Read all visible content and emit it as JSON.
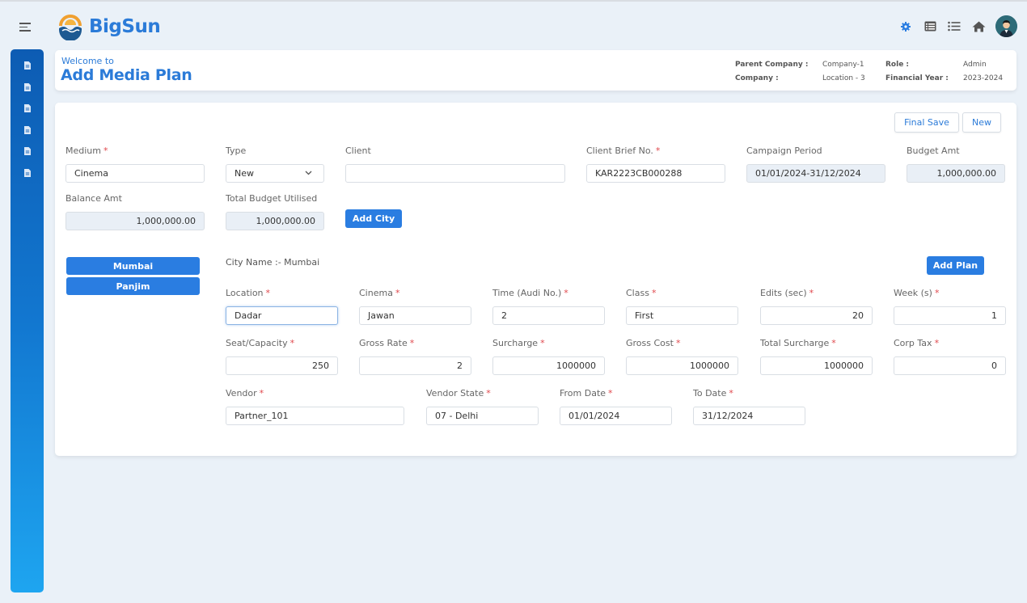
{
  "app": {
    "brand": "BigSun"
  },
  "topbar": {
    "icons": [
      "gear-icon",
      "table-icon",
      "list-icon",
      "home-icon",
      "user-avatar"
    ]
  },
  "sidebar": {
    "items": [
      {
        "icon": "document-icon"
      },
      {
        "icon": "document-icon"
      },
      {
        "icon": "document-icon"
      },
      {
        "icon": "document-icon"
      },
      {
        "icon": "document-icon"
      },
      {
        "icon": "document-icon"
      }
    ]
  },
  "header": {
    "welcome": "Welcome to",
    "title": "Add Media Plan",
    "info": {
      "parent_company_label": "Parent Company :",
      "parent_company_value": "Company-1",
      "company_label": "Company :",
      "company_value": "Location - 3",
      "role_label": "Role :",
      "role_value": "Admin",
      "fy_label": "Financial Year :",
      "fy_value": "2023-2024"
    }
  },
  "actions": {
    "final_save": "Final Save",
    "new": "New",
    "add_city": "Add City",
    "add_plan": "Add Plan"
  },
  "form": {
    "medium": {
      "label": "Medium",
      "value": "Cinema",
      "required": true
    },
    "type": {
      "label": "Type",
      "value": "New"
    },
    "client": {
      "label": "Client",
      "value": ""
    },
    "client_brief_no": {
      "label": "Client Brief No.",
      "value": "KAR2223CB000288",
      "required": true
    },
    "campaign_period": {
      "label": "Campaign Period",
      "value": "01/01/2024-31/12/2024"
    },
    "budget_amt": {
      "label": "Budget Amt",
      "value": "1,000,000.00"
    },
    "balance_amt": {
      "label": "Balance Amt",
      "value": "1,000,000.00"
    },
    "total_budget_utilised": {
      "label": "Total Budget Utilised",
      "value": "1,000,000.00"
    }
  },
  "cities": {
    "list": [
      "Mumbai",
      "Panjim"
    ],
    "selected_label": "City Name :- Mumbai"
  },
  "plan": {
    "location": {
      "label": "Location",
      "value": "Dadar"
    },
    "cinema": {
      "label": "Cinema",
      "value": "Jawan"
    },
    "time": {
      "label": "Time (Audi No.)",
      "value": "2"
    },
    "class": {
      "label": "Class",
      "value": "First"
    },
    "edits": {
      "label": "Edits (sec)",
      "value": "20"
    },
    "weeks": {
      "label": "Week (s)",
      "value": "1"
    },
    "seat_capacity": {
      "label": "Seat/Capacity",
      "value": "250"
    },
    "gross_rate": {
      "label": "Gross Rate",
      "value": "2"
    },
    "surcharge": {
      "label": "Surcharge",
      "value": "1000000"
    },
    "gross_cost": {
      "label": "Gross Cost",
      "value": "1000000"
    },
    "total_surcharge": {
      "label": "Total Surcharge",
      "value": "1000000"
    },
    "corp_tax": {
      "label": "Corp Tax",
      "value": "0"
    },
    "vendor": {
      "label": "Vendor",
      "value": "Partner_101"
    },
    "vendor_state": {
      "label": "Vendor State",
      "value": "07 - Delhi"
    },
    "from_date": {
      "label": "From Date",
      "value": "01/01/2024"
    },
    "to_date": {
      "label": "To Date",
      "value": "31/12/2024"
    },
    "required_mark": "*"
  },
  "colors": {
    "accent": "#2a7de1",
    "brand": "#2b7bd8",
    "required": "#e0474c",
    "readonly_bg": "#e9eff6",
    "sidebar_top": "#0d5cb3",
    "sidebar_bottom": "#1ea5f0"
  }
}
